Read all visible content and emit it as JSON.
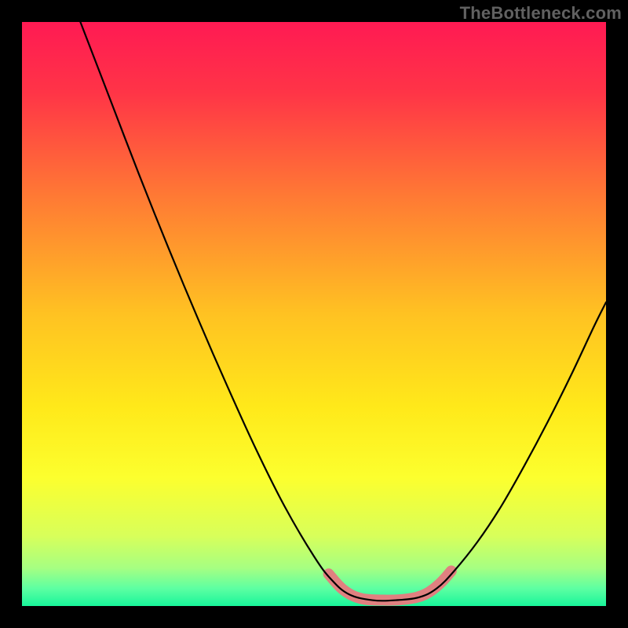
{
  "watermark": "TheBottleneck.com",
  "chart_data": {
    "type": "line",
    "title": "",
    "xlabel": "",
    "ylabel": "",
    "xlim": [
      0,
      100
    ],
    "ylim": [
      0,
      100
    ],
    "background_gradient_stops": [
      {
        "offset": 0.0,
        "color": "#ff1a53"
      },
      {
        "offset": 0.12,
        "color": "#ff3447"
      },
      {
        "offset": 0.3,
        "color": "#ff7a34"
      },
      {
        "offset": 0.5,
        "color": "#ffc222"
      },
      {
        "offset": 0.66,
        "color": "#ffe91a"
      },
      {
        "offset": 0.78,
        "color": "#fcff2e"
      },
      {
        "offset": 0.88,
        "color": "#d8ff5a"
      },
      {
        "offset": 0.935,
        "color": "#a6ff82"
      },
      {
        "offset": 0.97,
        "color": "#5dffa2"
      },
      {
        "offset": 1.0,
        "color": "#18f59a"
      }
    ],
    "series": [
      {
        "name": "bottleneck-curve",
        "color": "#000000",
        "width": 2.2,
        "points": [
          {
            "x": 10.0,
            "y": 100.0
          },
          {
            "x": 15.0,
            "y": 87.0
          },
          {
            "x": 20.0,
            "y": 74.0
          },
          {
            "x": 25.0,
            "y": 61.5
          },
          {
            "x": 30.0,
            "y": 49.5
          },
          {
            "x": 35.0,
            "y": 38.0
          },
          {
            "x": 40.0,
            "y": 27.0
          },
          {
            "x": 45.0,
            "y": 17.0
          },
          {
            "x": 50.0,
            "y": 8.5
          },
          {
            "x": 53.0,
            "y": 4.5
          },
          {
            "x": 56.0,
            "y": 2.0
          },
          {
            "x": 60.0,
            "y": 1.0
          },
          {
            "x": 64.0,
            "y": 1.0
          },
          {
            "x": 68.0,
            "y": 1.5
          },
          {
            "x": 71.0,
            "y": 3.0
          },
          {
            "x": 74.0,
            "y": 6.0
          },
          {
            "x": 78.0,
            "y": 11.0
          },
          {
            "x": 82.0,
            "y": 17.0
          },
          {
            "x": 86.0,
            "y": 24.0
          },
          {
            "x": 90.0,
            "y": 31.5
          },
          {
            "x": 94.0,
            "y": 39.5
          },
          {
            "x": 98.0,
            "y": 48.0
          },
          {
            "x": 100.0,
            "y": 52.0
          }
        ]
      },
      {
        "name": "highlight-segment",
        "color": "#e08080",
        "width": 14,
        "linecap": "round",
        "points": [
          {
            "x": 52.5,
            "y": 5.5
          },
          {
            "x": 55.0,
            "y": 2.8
          },
          {
            "x": 58.0,
            "y": 1.3
          },
          {
            "x": 62.0,
            "y": 1.0
          },
          {
            "x": 66.0,
            "y": 1.2
          },
          {
            "x": 69.0,
            "y": 2.0
          },
          {
            "x": 71.5,
            "y": 3.8
          },
          {
            "x": 73.5,
            "y": 6.0
          }
        ]
      }
    ]
  }
}
